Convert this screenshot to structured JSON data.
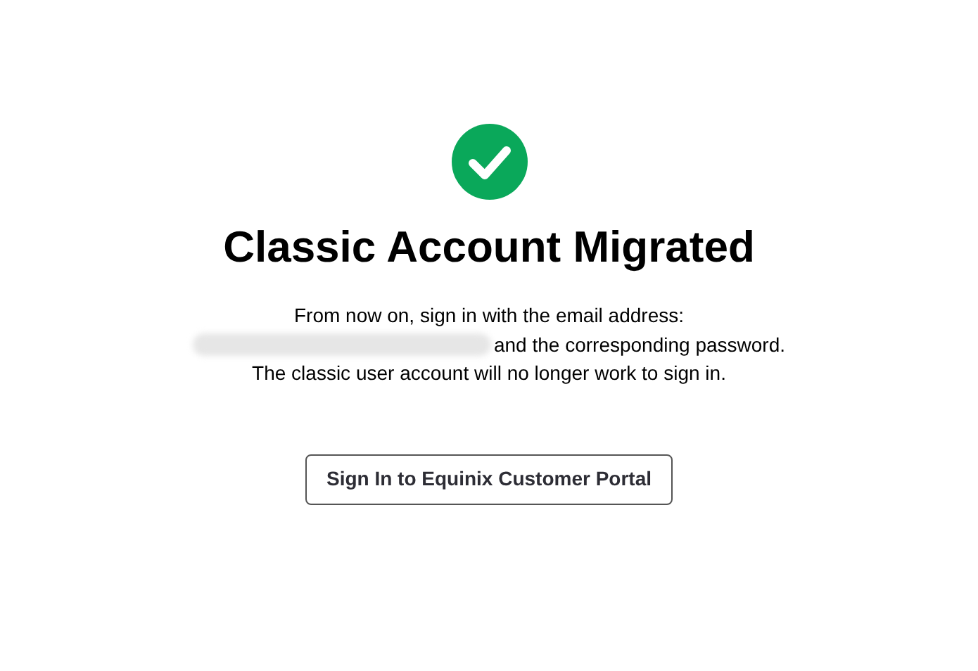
{
  "title": "Classic Account Migrated",
  "message": {
    "line_1": "From now on, sign in with the email address:",
    "line_2": "and the corresponding password.",
    "line_3": "The classic user account will no longer work to sign in."
  },
  "button": {
    "label": "Sign In to Equinix Customer Portal"
  }
}
